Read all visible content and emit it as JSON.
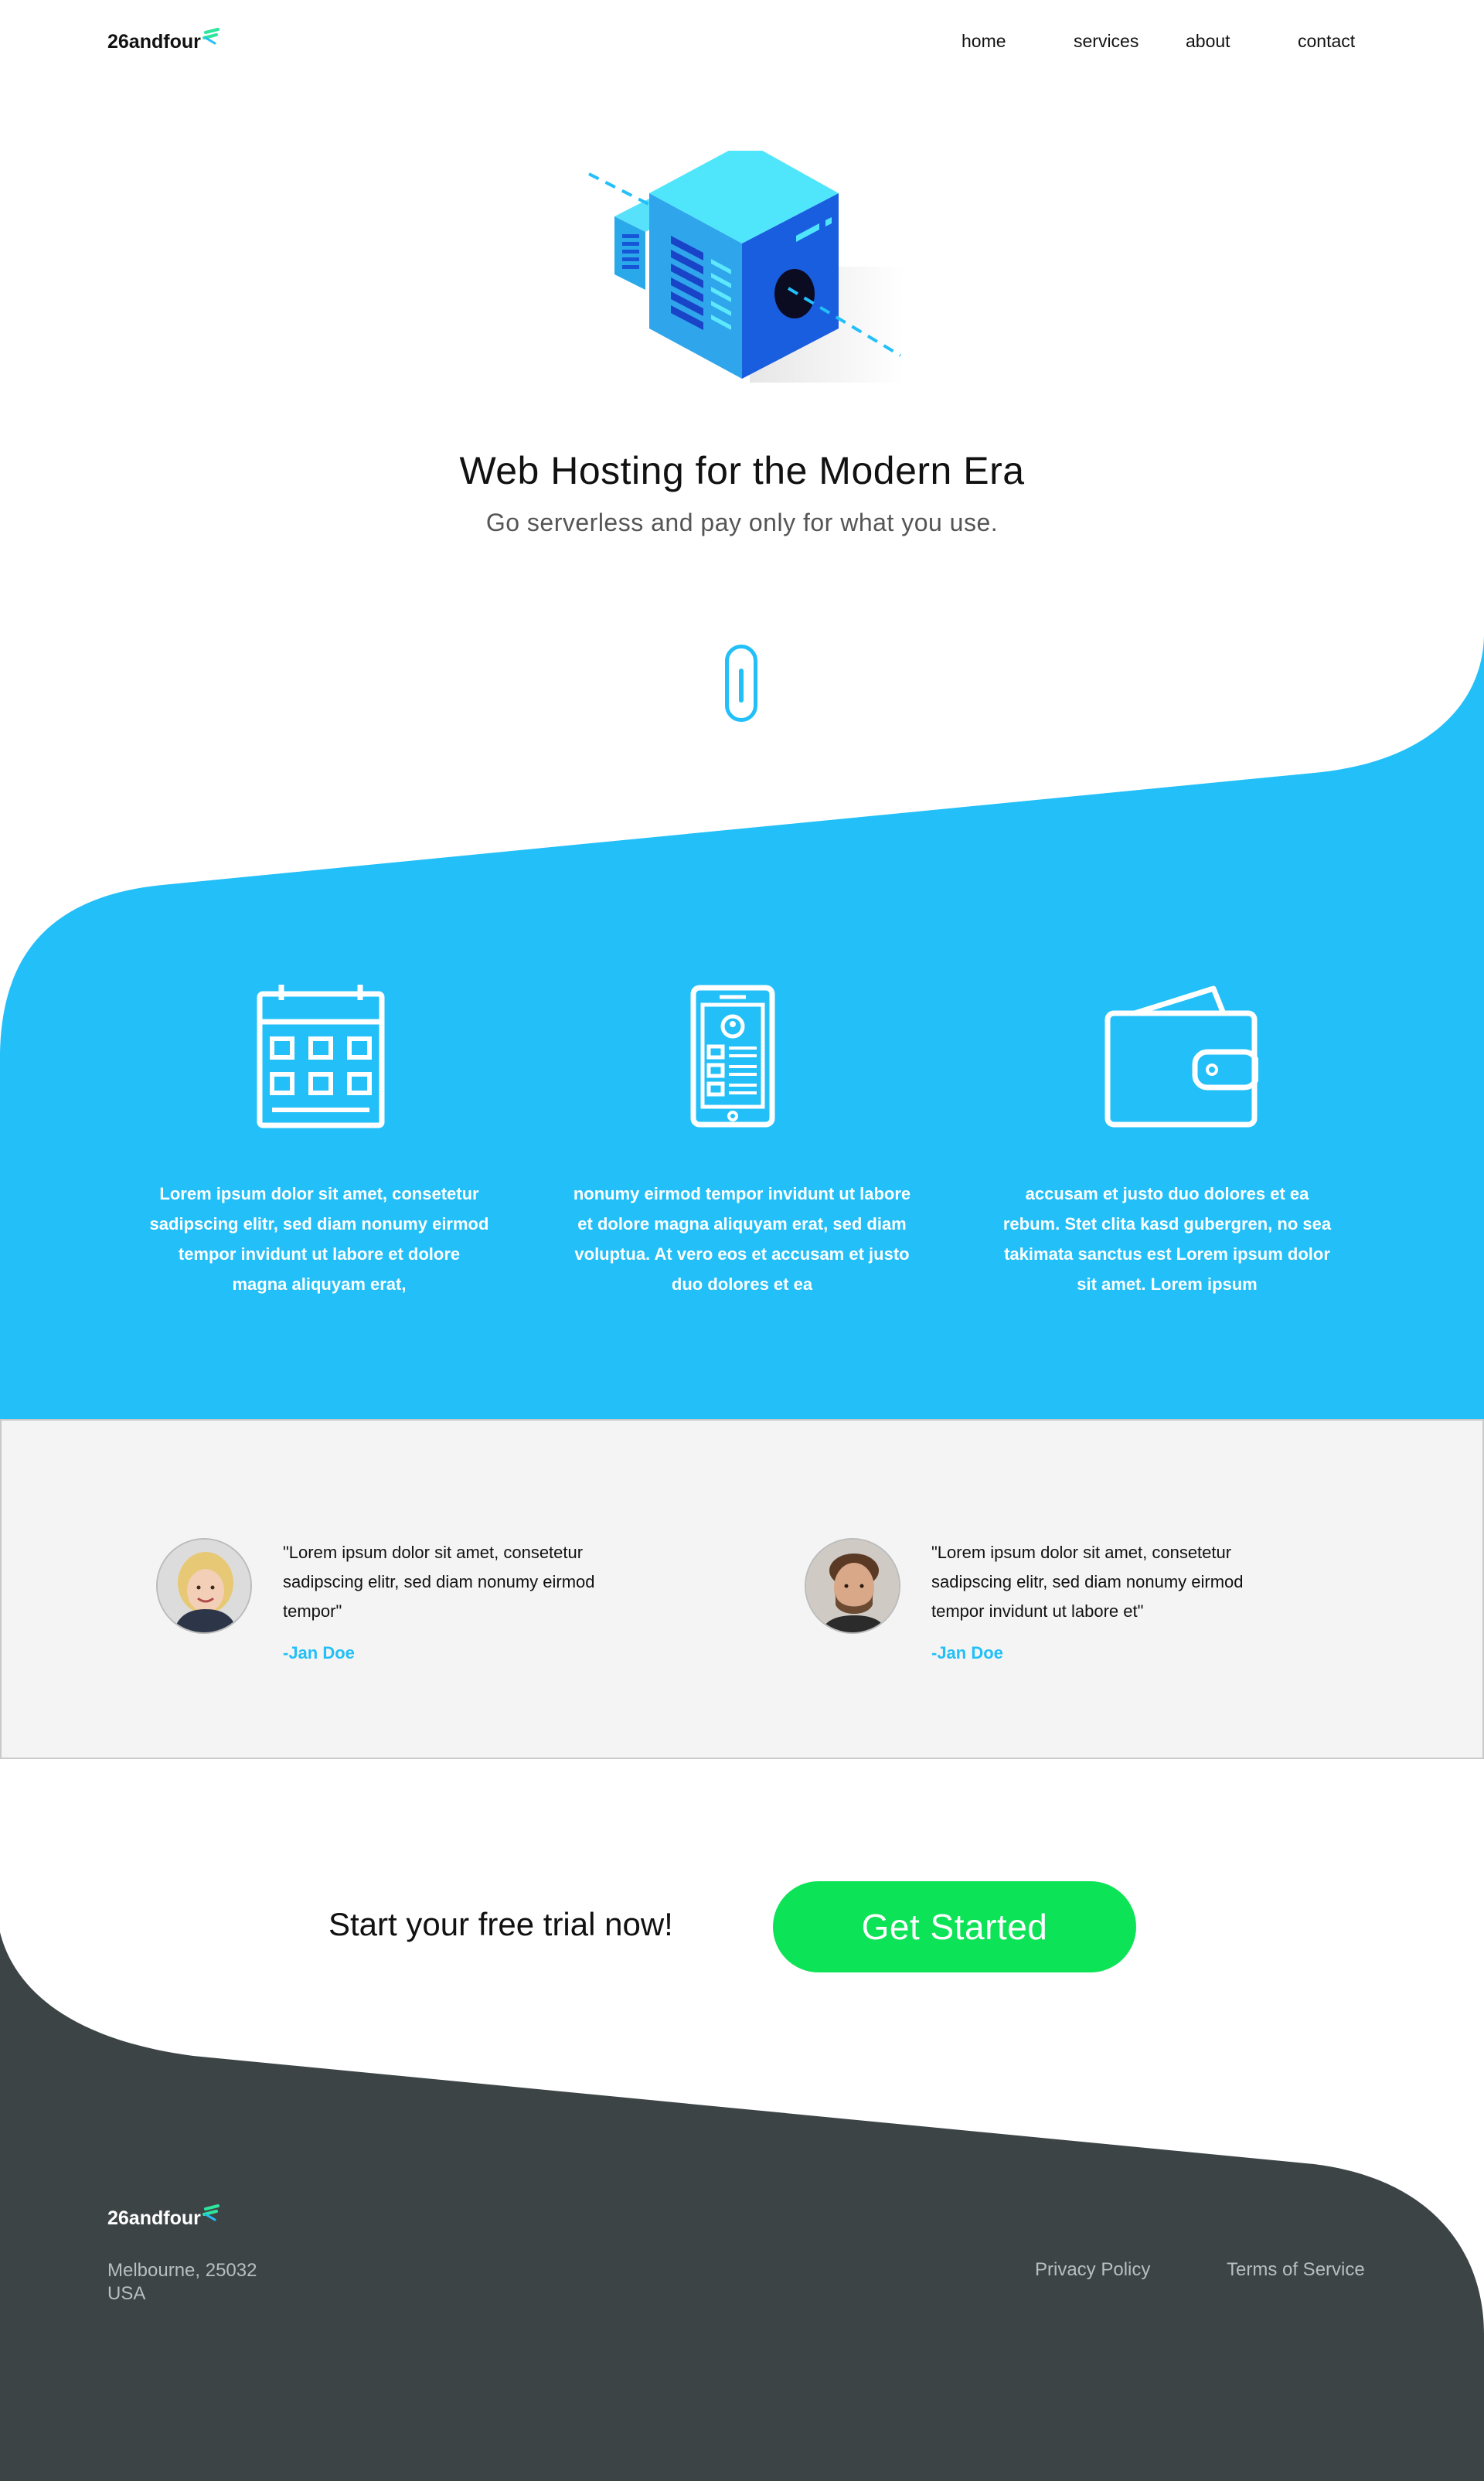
{
  "nav": {
    "brand": "26andfour",
    "links": [
      "home",
      "services",
      "about",
      "contact"
    ]
  },
  "hero": {
    "title": "Web Hosting for the Modern Era",
    "subtitle": "Go serverless and pay only for what you use."
  },
  "features": [
    {
      "icon": "calendar-icon",
      "text": "Lorem ipsum dolor sit amet, consetetur sadipscing elitr, sed diam nonumy eirmod tempor invidunt ut labore et dolore magna aliquyam erat,"
    },
    {
      "icon": "mobile-app-icon",
      "text": "nonumy eirmod tempor invidunt ut labore et dolore magna aliquyam erat, sed diam voluptua. At vero eos et accusam et justo duo dolores et ea"
    },
    {
      "icon": "wallet-icon",
      "text": "accusam et justo duo dolores et ea rebum. Stet clita kasd gubergren, no sea takimata sanctus est Lorem ipsum dolor sit amet. Lorem ipsum"
    }
  ],
  "testimonials": [
    {
      "quote": "\"Lorem ipsum dolor sit amet, consetetur sadipscing elitr, sed diam nonumy eirmod tempor\"",
      "author": "-Jan Doe"
    },
    {
      "quote": "\"Lorem ipsum dolor sit amet, consetetur sadipscing elitr, sed diam nonumy eirmod tempor invidunt ut labore et\"",
      "author": "-Jan Doe"
    }
  ],
  "cta": {
    "text": "Start your free trial now!",
    "button": "Get Started"
  },
  "footer": {
    "brand": "26andfour",
    "address_line1": "Melbourne, 25032",
    "address_line2": "USA",
    "links": [
      "Privacy Policy",
      "Terms of Service"
    ]
  },
  "colors": {
    "accent_blue": "#22bff8",
    "cta_green": "#0de356",
    "footer_dark": "#3d4446",
    "logo_green": "#2ee59d"
  }
}
